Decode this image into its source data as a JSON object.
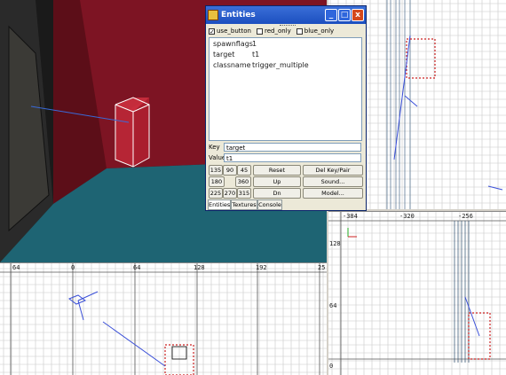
{
  "window": {
    "title": "Entities",
    "min_label": "_",
    "max_label": "□",
    "close_label": "x"
  },
  "spawnflags": [
    {
      "label": "use_button",
      "checked": true
    },
    {
      "label": "red_only",
      "checked": false
    },
    {
      "label": "blue_only",
      "checked": false
    }
  ],
  "properties": [
    {
      "key": "spawnflags",
      "value": "1"
    },
    {
      "key": "target",
      "value": "t1"
    },
    {
      "key": "classname",
      "value": "trigger_multiple"
    }
  ],
  "key_field": {
    "label": "Key",
    "value": "target"
  },
  "value_field": {
    "label": "Value",
    "value": "t1"
  },
  "angle_buttons": [
    "135",
    "90",
    "45",
    "180",
    "360",
    "225",
    "270",
    "315"
  ],
  "action_buttons": {
    "reset": "Reset",
    "up": "Up",
    "dn": "Dn",
    "delkey": "Del Key/Pair",
    "sound": "Sound...",
    "model": "Model..."
  },
  "tabs": [
    "Entities",
    "Textures",
    "Console"
  ],
  "rulers": {
    "xy_top": [
      "64",
      "0",
      "64",
      "128",
      "192",
      "25"
    ],
    "xz_top": [
      "-384",
      "-320",
      "-256"
    ],
    "xz_left": [
      "128",
      "64",
      "0"
    ]
  },
  "check_mark": "✓",
  "colors": {
    "brush_red": "#cc2222",
    "grid": "#c8c8c8",
    "entity_line": "#3a4fd8",
    "floor": "#1d6370",
    "wall": "#7a1220"
  }
}
